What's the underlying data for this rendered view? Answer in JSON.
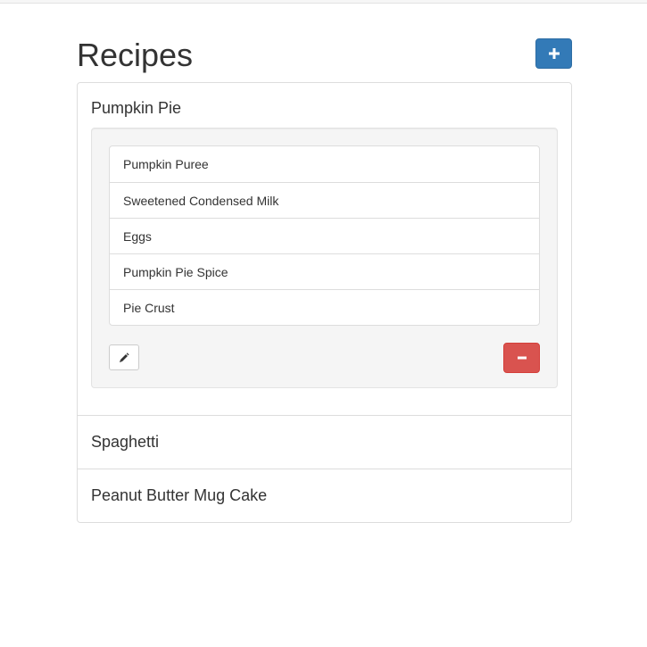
{
  "page": {
    "title": "Recipes"
  },
  "toolbar": {
    "add_icon": "plus-icon"
  },
  "recipes": [
    {
      "name": "Pumpkin Pie",
      "expanded": true,
      "ingredients": [
        "Pumpkin Puree",
        "Sweetened Condensed Milk",
        "Eggs",
        "Pumpkin Pie Spice",
        "Pie Crust"
      ],
      "edit_icon": "pencil-icon",
      "delete_icon": "minus-icon"
    },
    {
      "name": "Spaghetti",
      "expanded": false
    },
    {
      "name": "Peanut Butter Mug Cake",
      "expanded": false
    }
  ],
  "colors": {
    "primary": "#337ab7",
    "danger": "#d9534f",
    "border": "#dddddd",
    "well": "#f5f5f5"
  }
}
